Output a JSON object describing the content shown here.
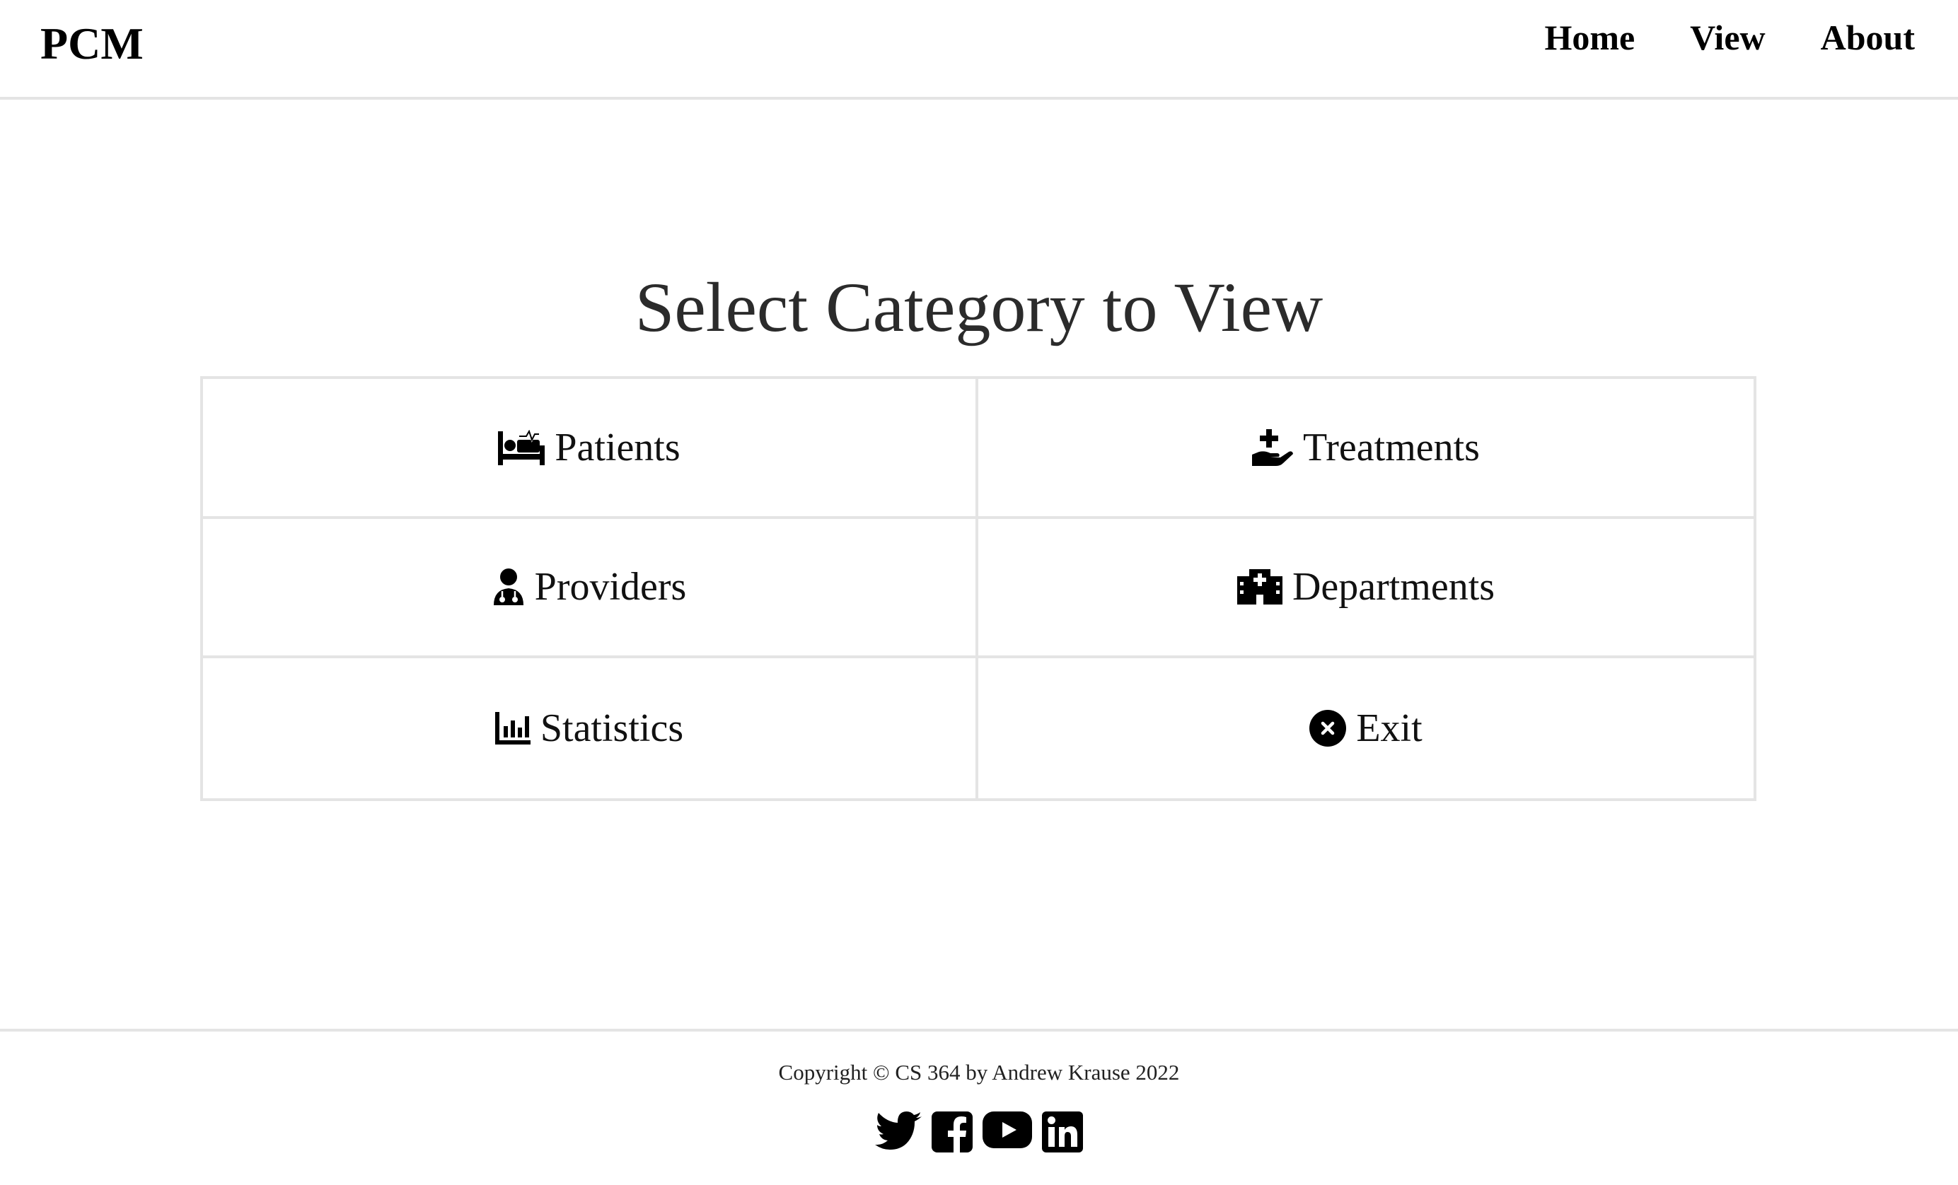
{
  "header": {
    "brand": "PCM",
    "nav": [
      {
        "label": "Home"
      },
      {
        "label": "View"
      },
      {
        "label": "About"
      }
    ]
  },
  "main": {
    "title": "Select Category to View",
    "categories": [
      {
        "label": "Patients",
        "icon": "hospital-bed-icon"
      },
      {
        "label": "Treatments",
        "icon": "hand-holding-medical-icon"
      },
      {
        "label": "Providers",
        "icon": "doctor-icon"
      },
      {
        "label": "Departments",
        "icon": "hospital-icon"
      },
      {
        "label": "Statistics",
        "icon": "bar-chart-icon"
      },
      {
        "label": "Exit",
        "icon": "circle-x-icon"
      }
    ]
  },
  "footer": {
    "copyright": "Copyright © CS 364 by Andrew Krause 2022",
    "social": [
      {
        "icon": "twitter-icon"
      },
      {
        "icon": "facebook-icon"
      },
      {
        "icon": "youtube-icon"
      },
      {
        "icon": "linkedin-icon"
      }
    ]
  },
  "colors": {
    "border": "#e4e4e4",
    "text": "#000000",
    "heading": "#2b2b2b"
  }
}
